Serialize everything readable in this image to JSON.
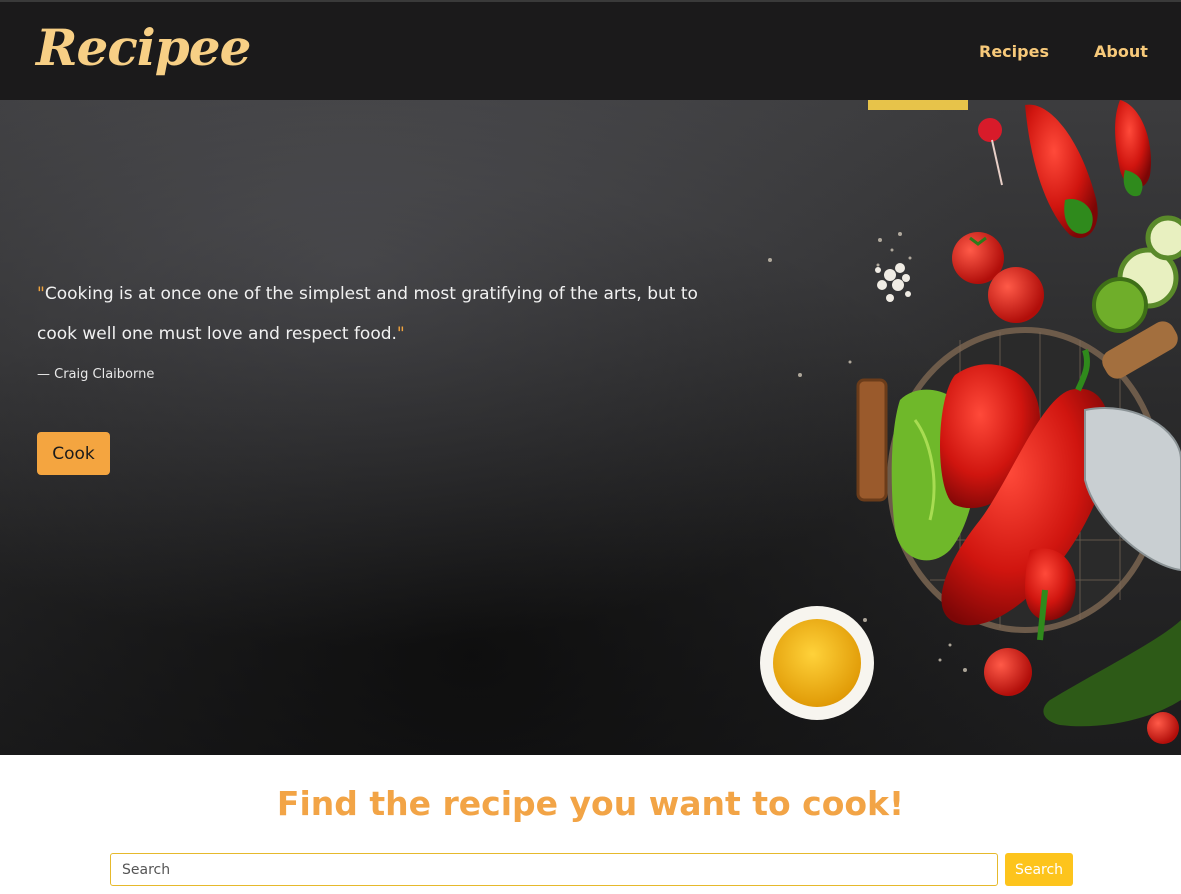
{
  "brand": {
    "logo_text": "Recipee",
    "accent_color": "#f4a540"
  },
  "nav": {
    "items": [
      {
        "label": "Recipes"
      },
      {
        "label": "About"
      }
    ]
  },
  "hero": {
    "quote_open": "\"",
    "quote_text": "Cooking is at once one of the simplest and most gratifying of the arts, but to cook well one must love and respect food.",
    "quote_close": "\"",
    "author": "— Craig Claiborne",
    "cta_label": "Cook",
    "image_subject": "vegetables-on-dark-board"
  },
  "search": {
    "heading": "Find the recipe you want to cook!",
    "placeholder": "Search",
    "button_label": "Search"
  }
}
